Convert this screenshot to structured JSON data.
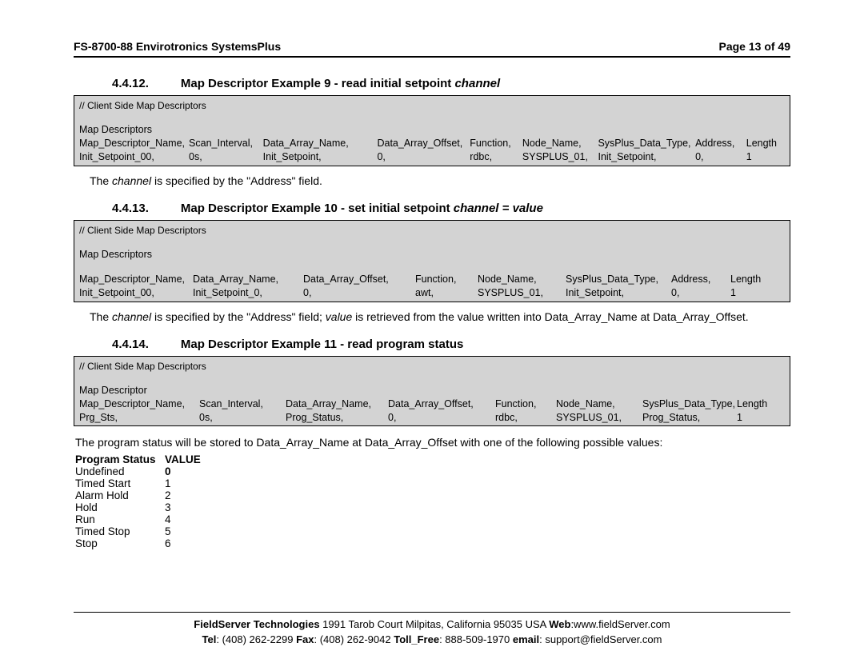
{
  "header": {
    "left": "FS-8700-88 Envirotronics SystemsPlus",
    "right": "Page 13 of 49"
  },
  "s1": {
    "num": "4.4.12.",
    "title_a": "Map Descriptor Example 9 - read initial setpoint ",
    "title_i": "channel",
    "comment": "//    Client Side Map Descriptors",
    "label": "Map Descriptors",
    "cols": [
      "Map_Descriptor_Name,",
      "Scan_Interval,",
      "Data_Array_Name,",
      "Data_Array_Offset,",
      "Function,",
      "Node_Name,",
      "SysPlus_Data_Type,",
      "Address,",
      "Length"
    ],
    "vals": [
      "Init_Setpoint_00,",
      "0s,",
      "Init_Setpoint,",
      "0,",
      "rdbc,",
      "SYSPLUS_01,",
      "Init_Setpoint,",
      "0,",
      "1"
    ],
    "widths": [
      142,
      96,
      148,
      120,
      68,
      98,
      126,
      66,
      50
    ],
    "note_pre": "The ",
    "note_i": "channel",
    "note_post": " is specified by the \"Address\" field."
  },
  "s2": {
    "num": "4.4.13.",
    "title_a": "Map Descriptor Example 10 - set initial setpoint ",
    "title_i": "channel = value",
    "comment": "//    Client Side Map Descriptors",
    "label": "Map Descriptors",
    "cols": [
      "Map_Descriptor_Name,",
      "Data_Array_Name,",
      "Data_Array_Offset,",
      "Function,",
      "Node_Name,",
      "SysPlus_Data_Type,",
      "Address,",
      "Length"
    ],
    "vals": [
      "Init_Setpoint_00,",
      "Init_Setpoint_0,",
      "0,",
      "awt,",
      "SYSPLUS_01,",
      "Init_Setpoint,",
      "0,",
      "1"
    ],
    "widths": [
      142,
      138,
      140,
      78,
      110,
      132,
      74,
      50
    ],
    "note_pre": "The ",
    "note_i1": "channel",
    "note_mid": " is specified by the \"Address\" field; ",
    "note_i2": "value",
    "note_post": " is retrieved from the value written into Data_Array_Name at Data_Array_Offset."
  },
  "s3": {
    "num": "4.4.14.",
    "title": "Map Descriptor Example 11 - read program status",
    "comment": "//    Client Side Map Descriptors",
    "label": "Map Descriptor",
    "cols": [
      "Map_Descriptor_Name,",
      "Scan_Interval,",
      "Data_Array_Name,",
      "Data_Array_Offset,",
      "Function,",
      "Node_Name,",
      "SysPlus_Data_Type,",
      "Length"
    ],
    "vals": [
      "Prg_Sts,",
      "0s,",
      "Prog_Status,",
      "0,",
      "rdbc,",
      "SYSPLUS_01,",
      "Prog_Status,",
      "1"
    ],
    "widths": [
      150,
      108,
      128,
      134,
      76,
      108,
      118,
      50
    ]
  },
  "ps": {
    "intro": "The program status will be stored to Data_Array_Name at Data_Array_Offset with one of the following possible values:",
    "hdr": [
      "Program Status",
      "VALUE"
    ],
    "rows": [
      [
        "Undefined",
        "0"
      ],
      [
        "Timed Start",
        "1"
      ],
      [
        "Alarm Hold",
        "2"
      ],
      [
        "Hold",
        "3"
      ],
      [
        "Run",
        "4"
      ],
      [
        "Timed Stop",
        "5"
      ],
      [
        "Stop",
        "6"
      ]
    ]
  },
  "footer": {
    "l1a": "FieldServer Technologies",
    "l1b": " 1991 Tarob Court Milpitas, California 95035 USA  ",
    "l1c": "Web",
    "l1d": ":www.fieldServer.com",
    "l2a": "Tel",
    "l2b": ": (408) 262-2299  ",
    "l2c": "Fax",
    "l2d": ": (408) 262-9042  ",
    "l2e": "Toll_Free",
    "l2f": ": 888-509-1970  ",
    "l2g": "email",
    "l2h": ": support@fieldServer.com"
  }
}
